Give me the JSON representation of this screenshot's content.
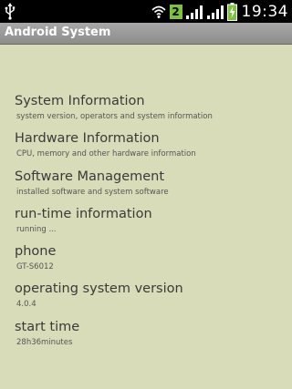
{
  "status_bar": {
    "sim_number": "2",
    "time": "19:34",
    "icons": [
      "usb-icon",
      "wifi-icon",
      "signal-icon",
      "signal-icon",
      "battery-charging-icon"
    ]
  },
  "app": {
    "title": "Android System"
  },
  "items": [
    {
      "title": "System Information",
      "subtitle": "system version, operators and system information"
    },
    {
      "title": "Hardware Information",
      "subtitle": "CPU, memory and other hardware information"
    },
    {
      "title": "Software Management",
      "subtitle": "installed software and system software"
    },
    {
      "title": "run-time information",
      "subtitle": "running ..."
    },
    {
      "title": "phone",
      "subtitle": "GT-S6012"
    },
    {
      "title": "operating system version",
      "subtitle": "4.0.4"
    },
    {
      "title": "start time",
      "subtitle": "28h36minutes"
    }
  ],
  "colors": {
    "background": "#d9dcb8",
    "title_bar": "#9a9a9a",
    "status_bar": "#000000",
    "sim_badge": "#7cc240"
  }
}
